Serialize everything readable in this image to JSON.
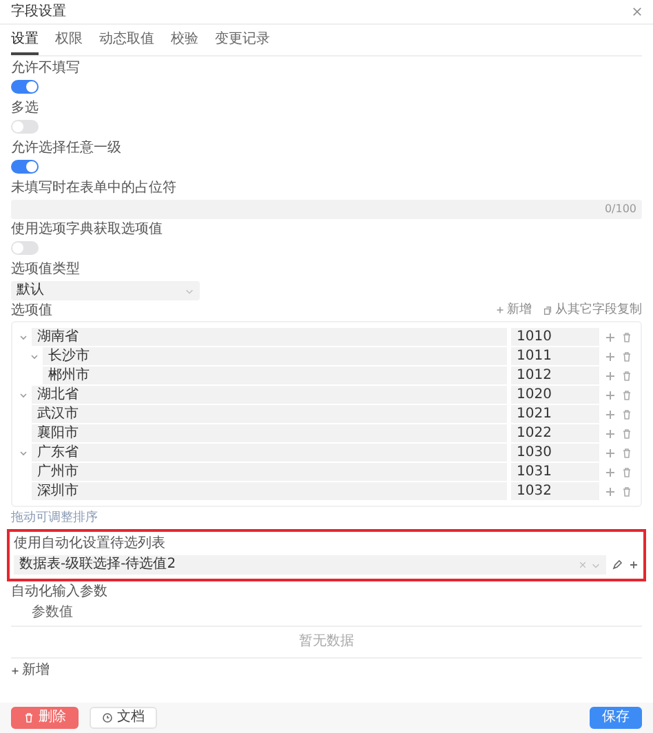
{
  "dialog": {
    "title": "字段设置"
  },
  "tabs": [
    {
      "label": "设置",
      "selected": true
    },
    {
      "label": "权限",
      "selected": false
    },
    {
      "label": "动态取值",
      "selected": false
    },
    {
      "label": "校验",
      "selected": false
    },
    {
      "label": "变更记录",
      "selected": false
    }
  ],
  "switches": [
    {
      "label": "允许不填写",
      "on": true
    },
    {
      "label": "多选",
      "on": false
    },
    {
      "label": "允许选择任意一级",
      "on": true
    }
  ],
  "placeholder_field": {
    "label": "未填写时在表单中的占位符",
    "counter": "0/100"
  },
  "dictionary_switch": {
    "label": "使用选项字典获取选项值",
    "on": false
  },
  "value_type": {
    "label": "选项值类型",
    "value": "默认"
  },
  "options": {
    "label": "选项值",
    "add": "新增",
    "copy": "从其它字段复制",
    "hint": "拖动可调整排序",
    "tree": [
      {
        "name": "湖南省",
        "code": "1010",
        "expanded": true,
        "children": [
          {
            "name": "长沙市",
            "code": "1011",
            "expanded": true,
            "children": [
              {
                "name": "郴州市",
                "code": "1012"
              }
            ]
          }
        ]
      },
      {
        "name": "湖北省",
        "code": "1020",
        "expanded": true,
        "children": [
          {
            "name": "武汉市",
            "code": "1021"
          },
          {
            "name": "襄阳市",
            "code": "1022"
          }
        ]
      },
      {
        "name": "广东省",
        "code": "1030",
        "expanded": true,
        "children": [
          {
            "name": "广州市",
            "code": "1031"
          },
          {
            "name": "深圳市",
            "code": "1032"
          }
        ]
      }
    ]
  },
  "automation_list": {
    "label": "使用自动化设置待选列表",
    "value": "数据表-级联选择-待选值2",
    "highlighted": true
  },
  "automation_params": {
    "label": "自动化输入参数",
    "column": "参数值",
    "empty": "暂无数据",
    "add": "新增"
  },
  "footer": {
    "delete": "删除",
    "docs": "文档",
    "save": "保存"
  }
}
